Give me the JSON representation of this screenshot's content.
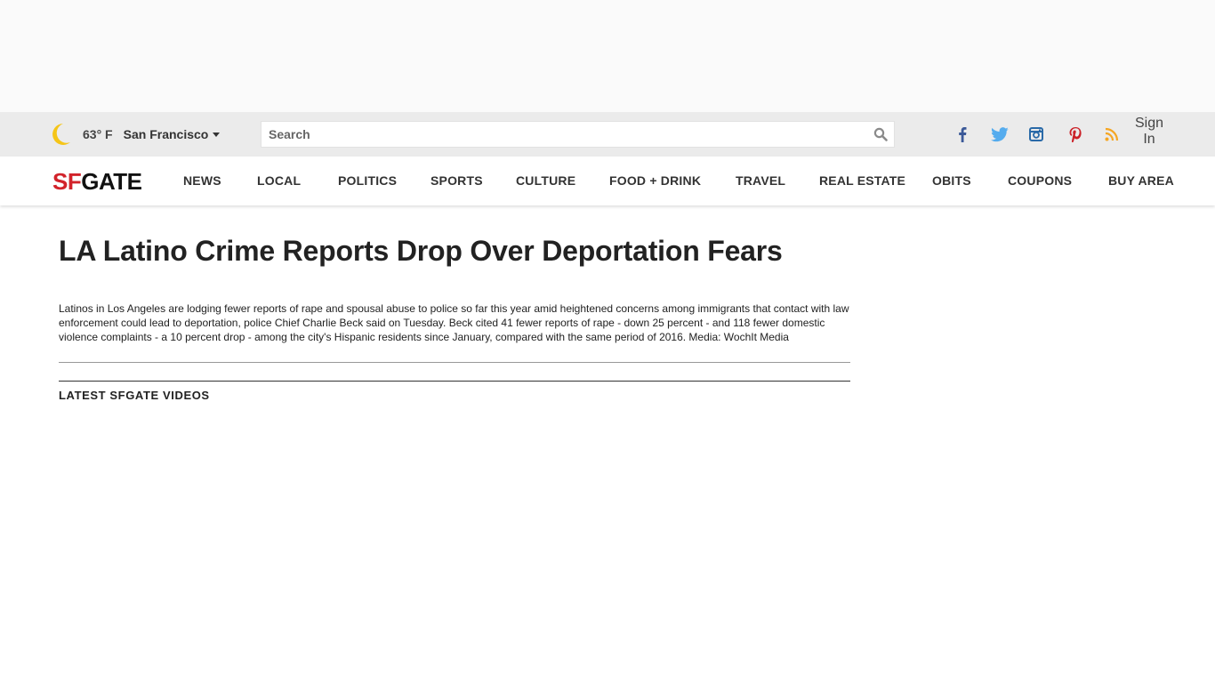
{
  "utility": {
    "weather_icon": "moon-icon",
    "temperature": "63° F",
    "city": "San Francisco",
    "search_placeholder": "Search",
    "social_icons": [
      "facebook-icon",
      "twitter-icon",
      "instagram-icon",
      "pinterest-icon",
      "rss-icon"
    ],
    "signin_label": "Sign In",
    "colors": {
      "moon": "#f5c518",
      "facebook": "#3b5998",
      "twitter": "#55acee",
      "instagram": "#2a6aa8",
      "pinterest": "#cb2027",
      "rss": "#f5a623"
    }
  },
  "nav": {
    "logo_sf": "SF",
    "logo_gate": "GATE",
    "logo_color": "#d2232a",
    "items": [
      "NEWS",
      "LOCAL",
      "POLITICS",
      "SPORTS",
      "CULTURE",
      "FOOD + DRINK",
      "TRAVEL",
      "REAL ESTATE",
      "OBITS",
      "COUPONS",
      "BUY AREA"
    ]
  },
  "article": {
    "headline": "LA Latino Crime Reports Drop Over Deportation Fears",
    "summary": "Latinos in Los Angeles are lodging fewer reports of rape and spousal abuse to police so far this year amid heightened concerns among immigrants that contact with law enforcement could lead to deportation, police Chief Charlie Beck said on Tuesday. Beck cited 41 fewer reports of rape - down 25 percent - and 118 fewer domestic violence complaints - a 10 percent drop - among the city's Hispanic residents since January, compared with the same period of 2016. Media: WochIt Media"
  },
  "videos": {
    "section_title": "LATEST SFGATE VIDEOS"
  }
}
